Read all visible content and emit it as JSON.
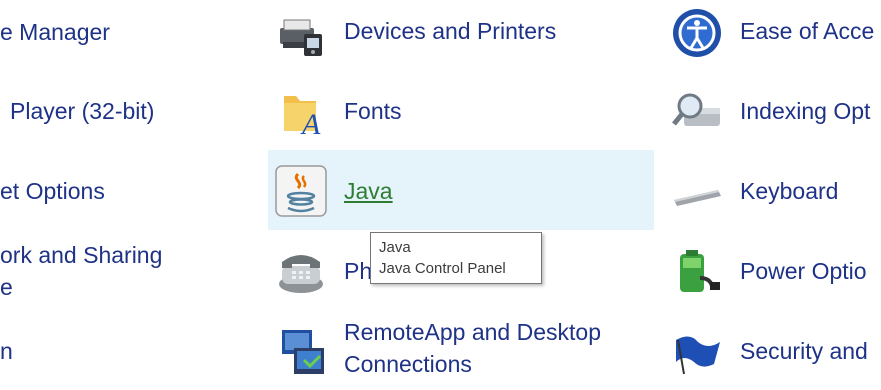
{
  "left_column": [
    {
      "label": "e Manager"
    },
    {
      "label": "Player (32-bit)"
    },
    {
      "label": "et Options"
    },
    {
      "label": "ork and Sharing"
    },
    {
      "label": "e"
    },
    {
      "label": "n"
    }
  ],
  "middle_column": [
    {
      "label": "Devices and Printers",
      "icon": "printer-icon"
    },
    {
      "label": "Fonts",
      "icon": "fonts-icon"
    },
    {
      "label": "Java",
      "icon": "java-icon"
    },
    {
      "label": "Ph",
      "icon": "phone-icon"
    },
    {
      "label": "RemoteApp and Desktop Connections",
      "icon": "remoteapp-icon"
    }
  ],
  "right_column": [
    {
      "label": "Ease of Acce",
      "icon": "ease-of-access-icon"
    },
    {
      "label": "Indexing Opt",
      "icon": "indexing-icon"
    },
    {
      "label": "Keyboard",
      "icon": "keyboard-icon"
    },
    {
      "label": "Power Optio",
      "icon": "power-icon"
    },
    {
      "label": "Security and",
      "icon": "security-flag-icon"
    }
  ],
  "tooltip": {
    "title": "Java",
    "description": "Java Control Panel"
  },
  "colors": {
    "link_text": "#1e3287",
    "hover_link_text": "#2e7d32",
    "hover_background": "#e5f3fb"
  }
}
